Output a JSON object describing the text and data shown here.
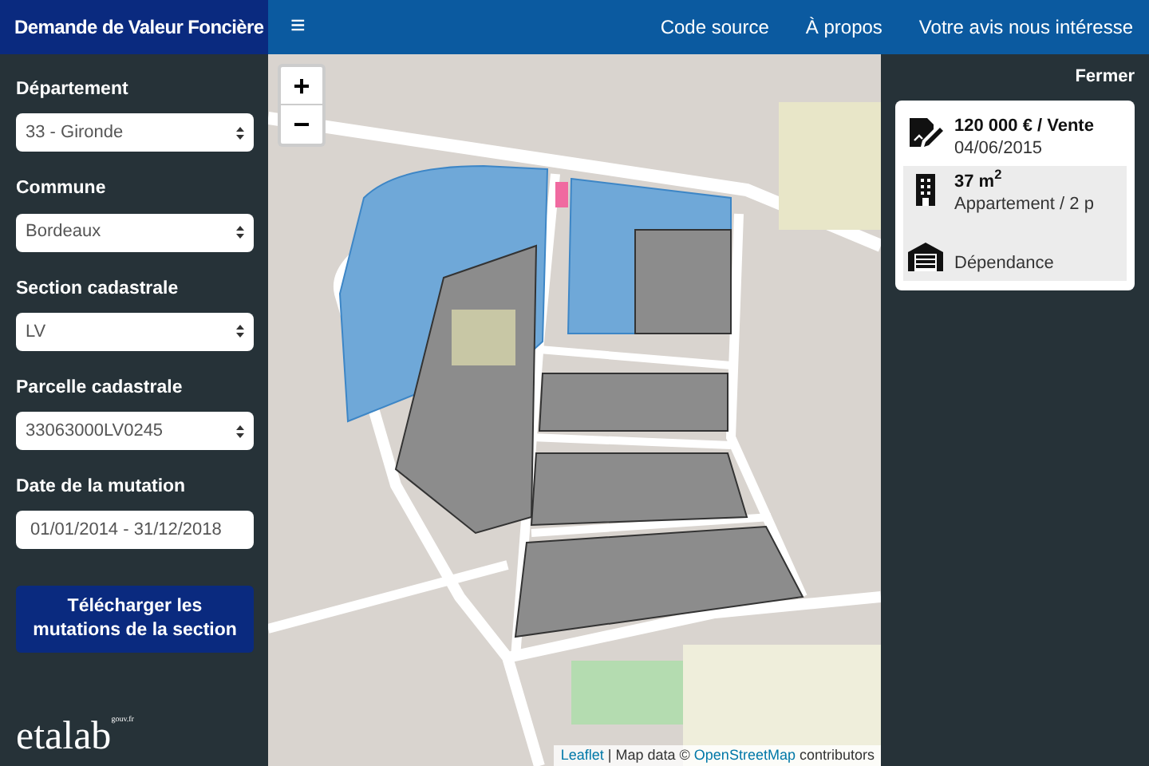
{
  "header": {
    "title": "Demande de Valeur Foncière",
    "menu_icon": "≡",
    "links": [
      "Code source",
      "À propos",
      "Votre avis nous intéresse"
    ]
  },
  "sidebar": {
    "fields": [
      {
        "kind": "select",
        "label": "Département",
        "value": "33 - Gironde"
      },
      {
        "kind": "select",
        "label": "Commune",
        "value": "Bordeaux"
      },
      {
        "kind": "select",
        "label": "Section cadastrale",
        "value": "LV"
      },
      {
        "kind": "select",
        "label": "Parcelle cadastrale",
        "value": "33063000LV0245"
      },
      {
        "kind": "text",
        "label": "Date de la mutation",
        "value": "01/01/2014 - 31/12/2018"
      }
    ],
    "download_button": "Télécharger les mutations de la section",
    "logo": {
      "name": "etalab",
      "suffix": "gouv.fr"
    }
  },
  "map": {
    "zoom_in": "+",
    "zoom_out": "−",
    "attribution": {
      "link_1": "Leaflet",
      "text_1": "| Map data ©",
      "link_2": "OpenStreetMap",
      "text_2": "contributors"
    }
  },
  "details": {
    "close": "Fermer",
    "rows": [
      {
        "kind": "sale",
        "title": "120 000 € / Vente",
        "subtitle": "04/06/2015",
        "shaded": false
      },
      {
        "kind": "apartment",
        "title": "37 m$^{2}$",
        "subtitle": "Appartement / 2 p",
        "shaded": true
      },
      {
        "kind": "outbuilding",
        "subtitle": "Dépendance",
        "shaded": true
      }
    ]
  }
}
